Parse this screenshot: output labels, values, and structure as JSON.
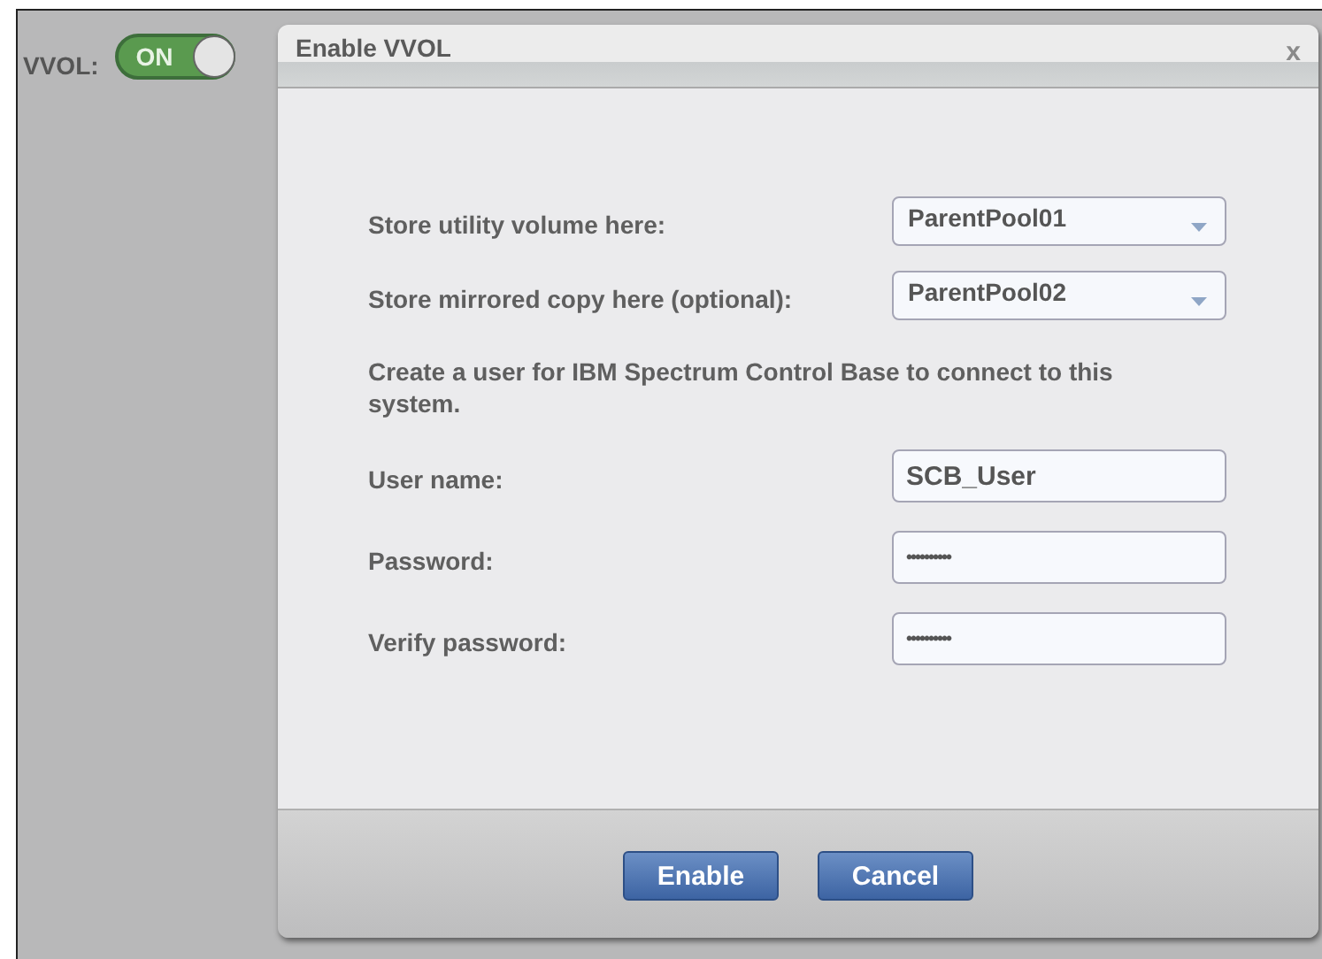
{
  "toggle": {
    "label": "VVOL:",
    "text": "ON",
    "on": true
  },
  "dialog": {
    "title": "Enable VVOL",
    "close": "x",
    "selects": [
      {
        "label": "Store utility volume here:",
        "value": "ParentPool01"
      },
      {
        "label": "Store mirrored copy here (optional):",
        "value": "ParentPool02"
      }
    ],
    "description": "Create a user for IBM Spectrum Control Base to connect to this system.",
    "fields": [
      {
        "label": "User name:",
        "value": "SCB_User",
        "kind": "text"
      },
      {
        "label": "Password:",
        "value": "••••••••••",
        "kind": "password"
      },
      {
        "label": "Verify password:",
        "value": "••••••••••",
        "kind": "password"
      }
    ],
    "buttons": [
      "Enable",
      "Cancel"
    ]
  }
}
